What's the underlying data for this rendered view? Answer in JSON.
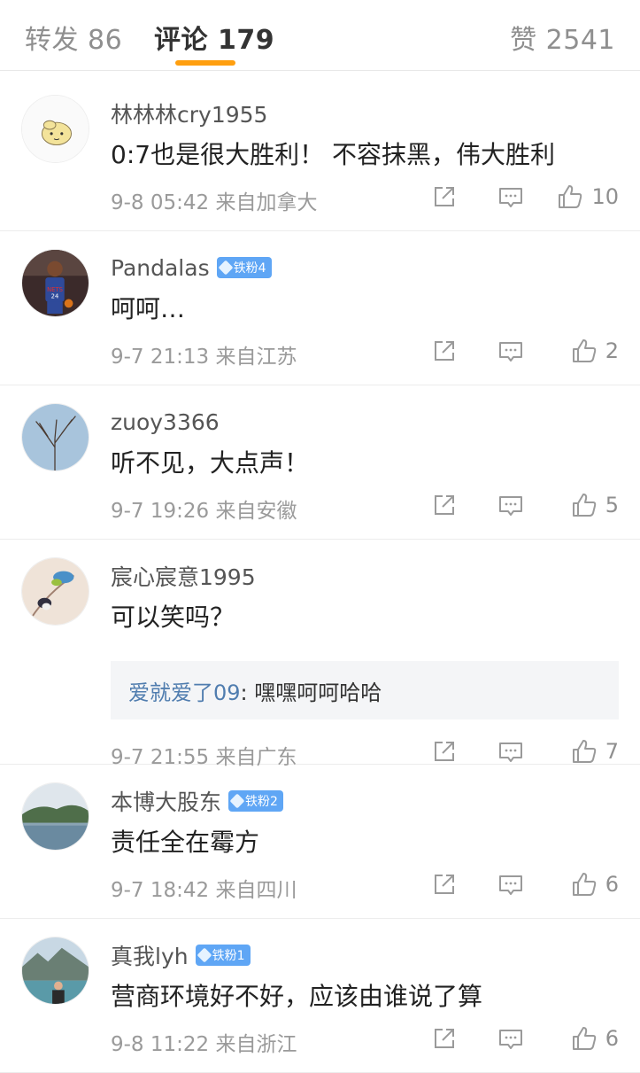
{
  "tabs": [
    {
      "label": "转发 86"
    },
    {
      "label": "评论 179"
    },
    {
      "label": "赞 2541"
    }
  ],
  "accent_color": "#ff9f0f",
  "icons": {
    "repost": "repost-icon",
    "comment": "comment-icon",
    "like": "thumbs-up-icon",
    "fan_badge": "diamond-icon"
  },
  "comments": [
    {
      "username": "林林林cry1955",
      "text": "0:7也是很大胜利！ 不容抹黑，伟大胜利",
      "time": "9-8 05:42",
      "location": "来自加拿大",
      "likes": "10"
    },
    {
      "username": "Pandalas",
      "badge": "铁粉4",
      "text": "呵呵…",
      "time": "9-7 21:13",
      "location": "来自江苏",
      "likes": "2"
    },
    {
      "username": "zuoy3366",
      "text": "听不见，大点声！",
      "time": "9-7 19:26",
      "location": "来自安徽",
      "likes": "5"
    },
    {
      "username": "宸心宸意1995",
      "text": "可以笑吗？",
      "reply": {
        "name": "爱就爱了09",
        "text": ": 嘿嘿呵呵哈哈"
      },
      "time": "9-7 21:55",
      "location": "来自广东",
      "likes": "7"
    },
    {
      "username": "本博大股东",
      "badge": "铁粉2",
      "text": "责任全在霉方",
      "time": "9-7 18:42",
      "location": "来自四川",
      "likes": "6"
    },
    {
      "username": "真我lyh",
      "badge": "铁粉1",
      "text": "营商环境好不好，应该由谁说了算",
      "time": "9-8 11:22",
      "location": "来自浙江",
      "likes": "6"
    }
  ]
}
